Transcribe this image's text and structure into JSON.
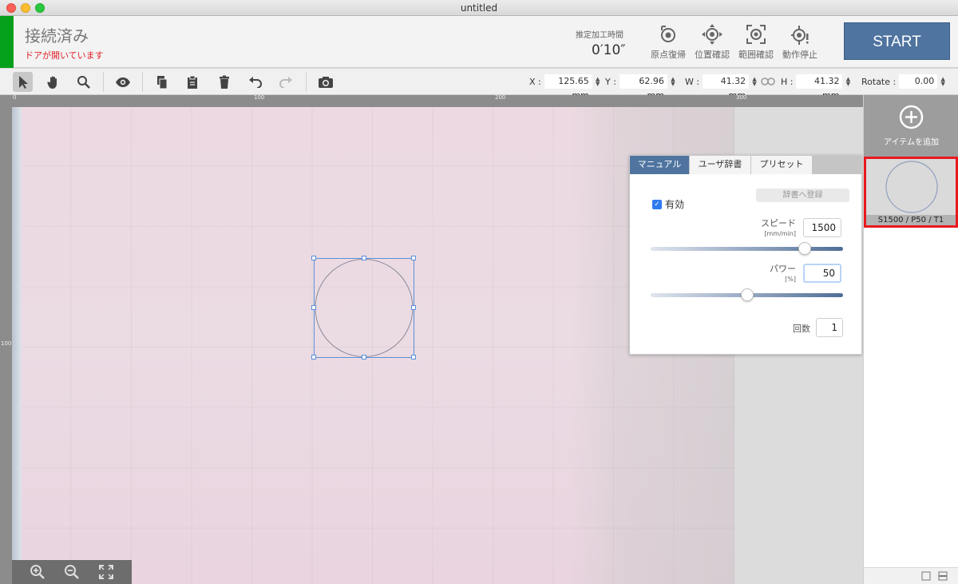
{
  "window": {
    "title": "untitled"
  },
  "header": {
    "status": "接続済み",
    "door_warning": "ドアが開いています",
    "est_label": "推定加工時間",
    "est_value": "0′10″",
    "buttons": [
      {
        "label": "原点復帰",
        "icon": "origin-return-icon"
      },
      {
        "label": "位置確認",
        "icon": "position-check-icon"
      },
      {
        "label": "範囲確認",
        "icon": "range-check-icon"
      },
      {
        "label": "動作停止",
        "icon": "stop-operation-icon"
      }
    ],
    "start_label": "START"
  },
  "toolbar": {
    "tools": [
      "select-tool-icon",
      "hand-tool-icon",
      "zoom-tool-icon",
      "preview-eye-icon",
      "copy-icon",
      "paste-icon",
      "trash-icon",
      "undo-icon",
      "redo-icon",
      "camera-icon"
    ],
    "x_label": "X :",
    "x_value": "125.65 mm",
    "y_label": "Y :",
    "y_value": "62.96 mm",
    "w_label": "W :",
    "w_value": "41.32 mm",
    "h_label": "H :",
    "h_value": "41.32 mm",
    "rotate_label": "Rotate :",
    "rotate_value": "0.00"
  },
  "ruler": {
    "top_labels": [
      "0",
      "100",
      "200",
      "300"
    ],
    "left_labels": [
      "100"
    ]
  },
  "panel": {
    "tabs": [
      "マニュアル",
      "ユーザ辞書",
      "プリセット"
    ],
    "active_tab": "マニュアル",
    "enabled_label": "有効",
    "enabled": true,
    "register_label": "辞書へ登録",
    "speed_label": "スピード",
    "speed_unit": "[mm/min]",
    "speed_value": "1500",
    "speed_slider_fraction": 0.8,
    "power_label": "パワー",
    "power_unit": "[%]",
    "power_value": "50",
    "power_slider_fraction": 0.5,
    "count_label": "回数",
    "count_value": "1"
  },
  "sidebar": {
    "add_label": "アイテムを追加",
    "items": [
      {
        "label": "S1500 / P50 / T1"
      }
    ]
  },
  "colors": {
    "accent": "#4f74a0",
    "connected": "#06a11c",
    "warning": "#e0202a",
    "selection": "#e8191f"
  }
}
